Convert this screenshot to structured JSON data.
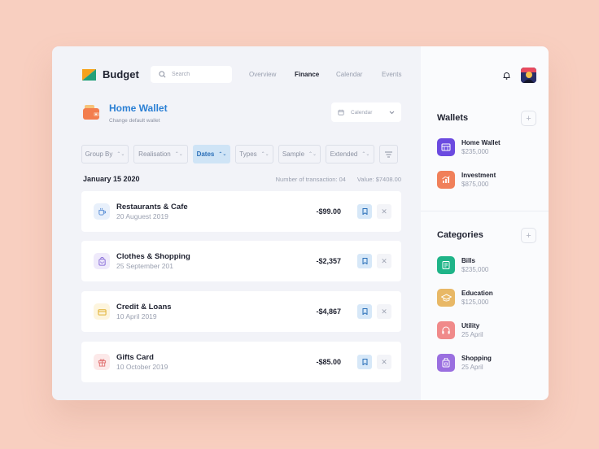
{
  "app": {
    "name": "Budget"
  },
  "search": {
    "placeholder": "Search"
  },
  "nav": [
    {
      "label": "Overview",
      "active": false
    },
    {
      "label": "Finance",
      "active": true
    },
    {
      "label": "Calendar",
      "active": false
    },
    {
      "label": "Events",
      "active": false
    }
  ],
  "wallet": {
    "title": "Home Wallet",
    "subtitle": "Change default wallet"
  },
  "calendar_select": {
    "label": "Calendar"
  },
  "filters": [
    {
      "label": "Group By",
      "active": false
    },
    {
      "label": "Realisation",
      "active": false
    },
    {
      "label": "Dates",
      "active": true
    },
    {
      "label": "Types",
      "active": false
    },
    {
      "label": "Sample",
      "active": false
    },
    {
      "label": "Extended",
      "active": false
    }
  ],
  "summary": {
    "date": "January 15 2020",
    "transactions": "Number of transaction: 04",
    "value": "Value: $7408.00"
  },
  "transactions": [
    {
      "name": "Restaurants & Cafe",
      "date": "20 Auguest 2019",
      "amount": "-$99.00",
      "icon": "coffee-icon",
      "color": "#5b8fd6",
      "bg": "#e8f0fb"
    },
    {
      "name": "Clothes & Shopping",
      "date": "25 September 201",
      "amount": "-$2,357",
      "icon": "bag-icon",
      "color": "#8a6fd8",
      "bg": "#efeafb"
    },
    {
      "name": "Credit & Loans",
      "date": "10 April 2019",
      "amount": "-$4,867",
      "icon": "card-icon",
      "color": "#e0b030",
      "bg": "#fdf5de"
    },
    {
      "name": "Gifts Card",
      "date": "10 October 2019",
      "amount": "-$85.00",
      "icon": "gift-icon",
      "color": "#e07070",
      "bg": "#fce9e9"
    }
  ],
  "sidebar": {
    "wallets_title": "Wallets",
    "wallets": [
      {
        "name": "Home Wallet",
        "value": "$235,000",
        "icon": "wallet-icon",
        "color": "#6b4ae0"
      },
      {
        "name": "Investment",
        "value": "$875,000",
        "icon": "chart-icon",
        "color": "#f0805a"
      }
    ],
    "categories_title": "Categories",
    "categories": [
      {
        "name": "Bills",
        "value": "$235,000",
        "icon": "bill-icon",
        "color": "#1fb488"
      },
      {
        "name": "Education",
        "value": "$125,000",
        "icon": "graduation-cap-icon",
        "color": "#e8b866"
      },
      {
        "name": "Utility",
        "value": "25 April",
        "icon": "headphones-icon",
        "color": "#f08a8a"
      },
      {
        "name": "Shopping",
        "value": "25 April",
        "icon": "shopping-icon",
        "color": "#9a6fe0"
      }
    ]
  }
}
